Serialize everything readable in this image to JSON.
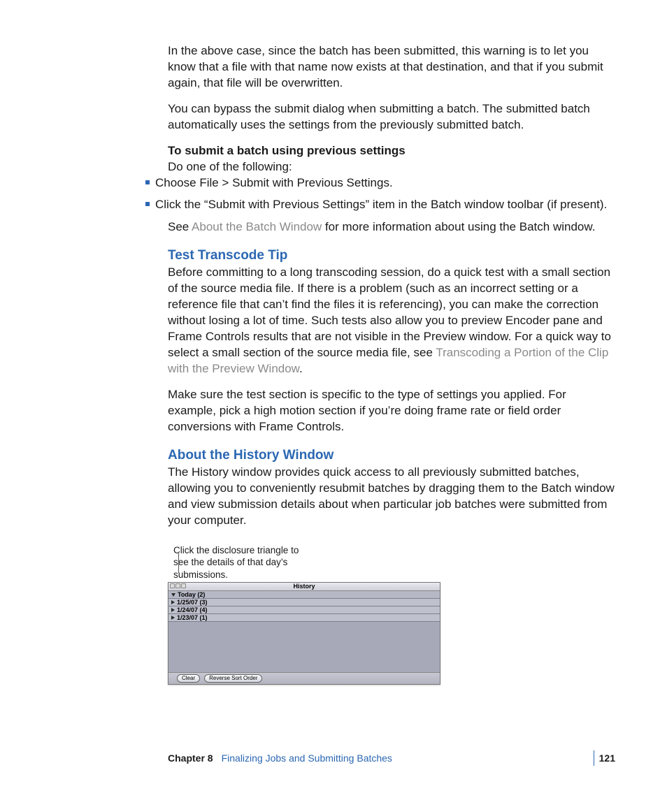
{
  "para1": "In the above case, since the batch has been submitted, this warning is to let you know that a file with that name now exists at that destination, and that if you submit again, that file will be overwritten.",
  "para2": "You can bypass the submit dialog when submitting a batch. The submitted batch automatically uses the settings from the previously submitted batch.",
  "instr_heading": "To submit a batch using previous settings",
  "instr_sub": "Do one of the following:",
  "bullet1": "Choose File > Submit with Previous Settings.",
  "bullet2": "Click the “Submit with Previous Settings” item in the Batch window toolbar (if present).",
  "see_prefix": "See ",
  "see_link": "About the Batch Window",
  "see_suffix": " for more information about using the Batch window.",
  "h_test": "Test Transcode Tip",
  "test_p1_a": "Before committing to a long transcoding session, do a quick test with a small section of the source media file. If there is a problem (such as an incorrect setting or a reference file that can’t find the files it is referencing), you can make the correction without losing a lot of time. Such tests also allow you to preview Encoder pane and Frame Controls results that are not visible in the Preview window. For a quick way to select a small section of the source media file, see ",
  "test_p1_link": "Transcoding a Portion of the Clip with the Preview Window",
  "test_p1_b": ".",
  "test_p2": "Make sure the test section is specific to the type of settings you applied. For example, pick a high motion section if you’re doing frame rate or field order conversions with Frame Controls.",
  "h_history": "About the History Window",
  "history_p1": "The History window provides quick access to all previously submitted batches, allowing you to conveniently resubmit batches by dragging them to the Batch window and view submission details about when particular job batches were submitted from your computer.",
  "callout": "Click the disclosure triangle to see the details of that day’s submissions.",
  "hw": {
    "title": "History",
    "rows": [
      "Today (2)",
      "1/25/07 (3)",
      "1/24/07 (4)",
      "1/23/07 (1)"
    ],
    "btn_clear": "Clear",
    "btn_reverse": "Reverse Sort Order"
  },
  "footer": {
    "chapter": "Chapter 8",
    "title": "Finalizing Jobs and Submitting Batches",
    "page": "121"
  }
}
